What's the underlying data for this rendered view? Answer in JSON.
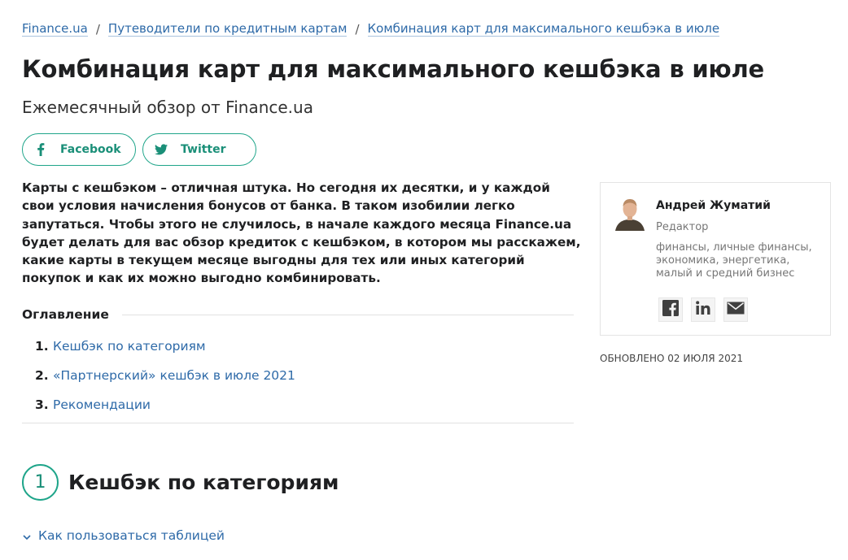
{
  "breadcrumb": {
    "items": [
      "Finance.ua",
      "Путеводители по кредитным картам",
      "Комбинация карт для максимального кешбэка в июле"
    ],
    "separator": "/"
  },
  "article": {
    "title": "Комбинация карт для максимального кешбэка в июле",
    "subtitle": "Ежемесячный обзор от Finance.ua",
    "lead": "Карты с кешбэком – отличная штука. Но сегодня их десятки, и у каждой свои условия начисления бонусов от банка. В таком изобилии легко запутаться. Чтобы этого не случилось, в начале каждого месяца Finance.ua будет делать для вас обзор кредиток с кешбэком, в котором мы расскажем, какие карты в текущем месяце выгодны для тех или иных категорий покупок и как их можно выгодно комбинировать."
  },
  "share": {
    "facebook_label": "Facebook",
    "twitter_label": "Twitter",
    "facebook_icon": "facebook-icon",
    "twitter_icon": "twitter-icon"
  },
  "toc": {
    "title": "Оглавление",
    "items": [
      {
        "num": "1.",
        "label": "Кешбэк по категориям"
      },
      {
        "num": "2.",
        "label": "«Партнерский» кешбэк в июле 2021"
      },
      {
        "num": "3.",
        "label": "Рекомендации"
      }
    ]
  },
  "section1": {
    "number": "1",
    "title": "Кешбэк по категориям",
    "howto_label": "Как пользоваться таблицей",
    "howto_icon": "chevron-down-icon"
  },
  "author": {
    "name": "Андрей Жуматий",
    "role": "Редактор",
    "topics": "финансы, личные финансы, экономика, энергетика, малый и средний бизнес",
    "social_icons": [
      "facebook-icon",
      "linkedin-icon",
      "mail-icon"
    ]
  },
  "updated": "ОБНОВЛЕНО 02 ИЮЛЯ 2021",
  "colors": {
    "accent": "#1fa58a",
    "link": "#2e6aa8",
    "text": "#1f2022"
  }
}
